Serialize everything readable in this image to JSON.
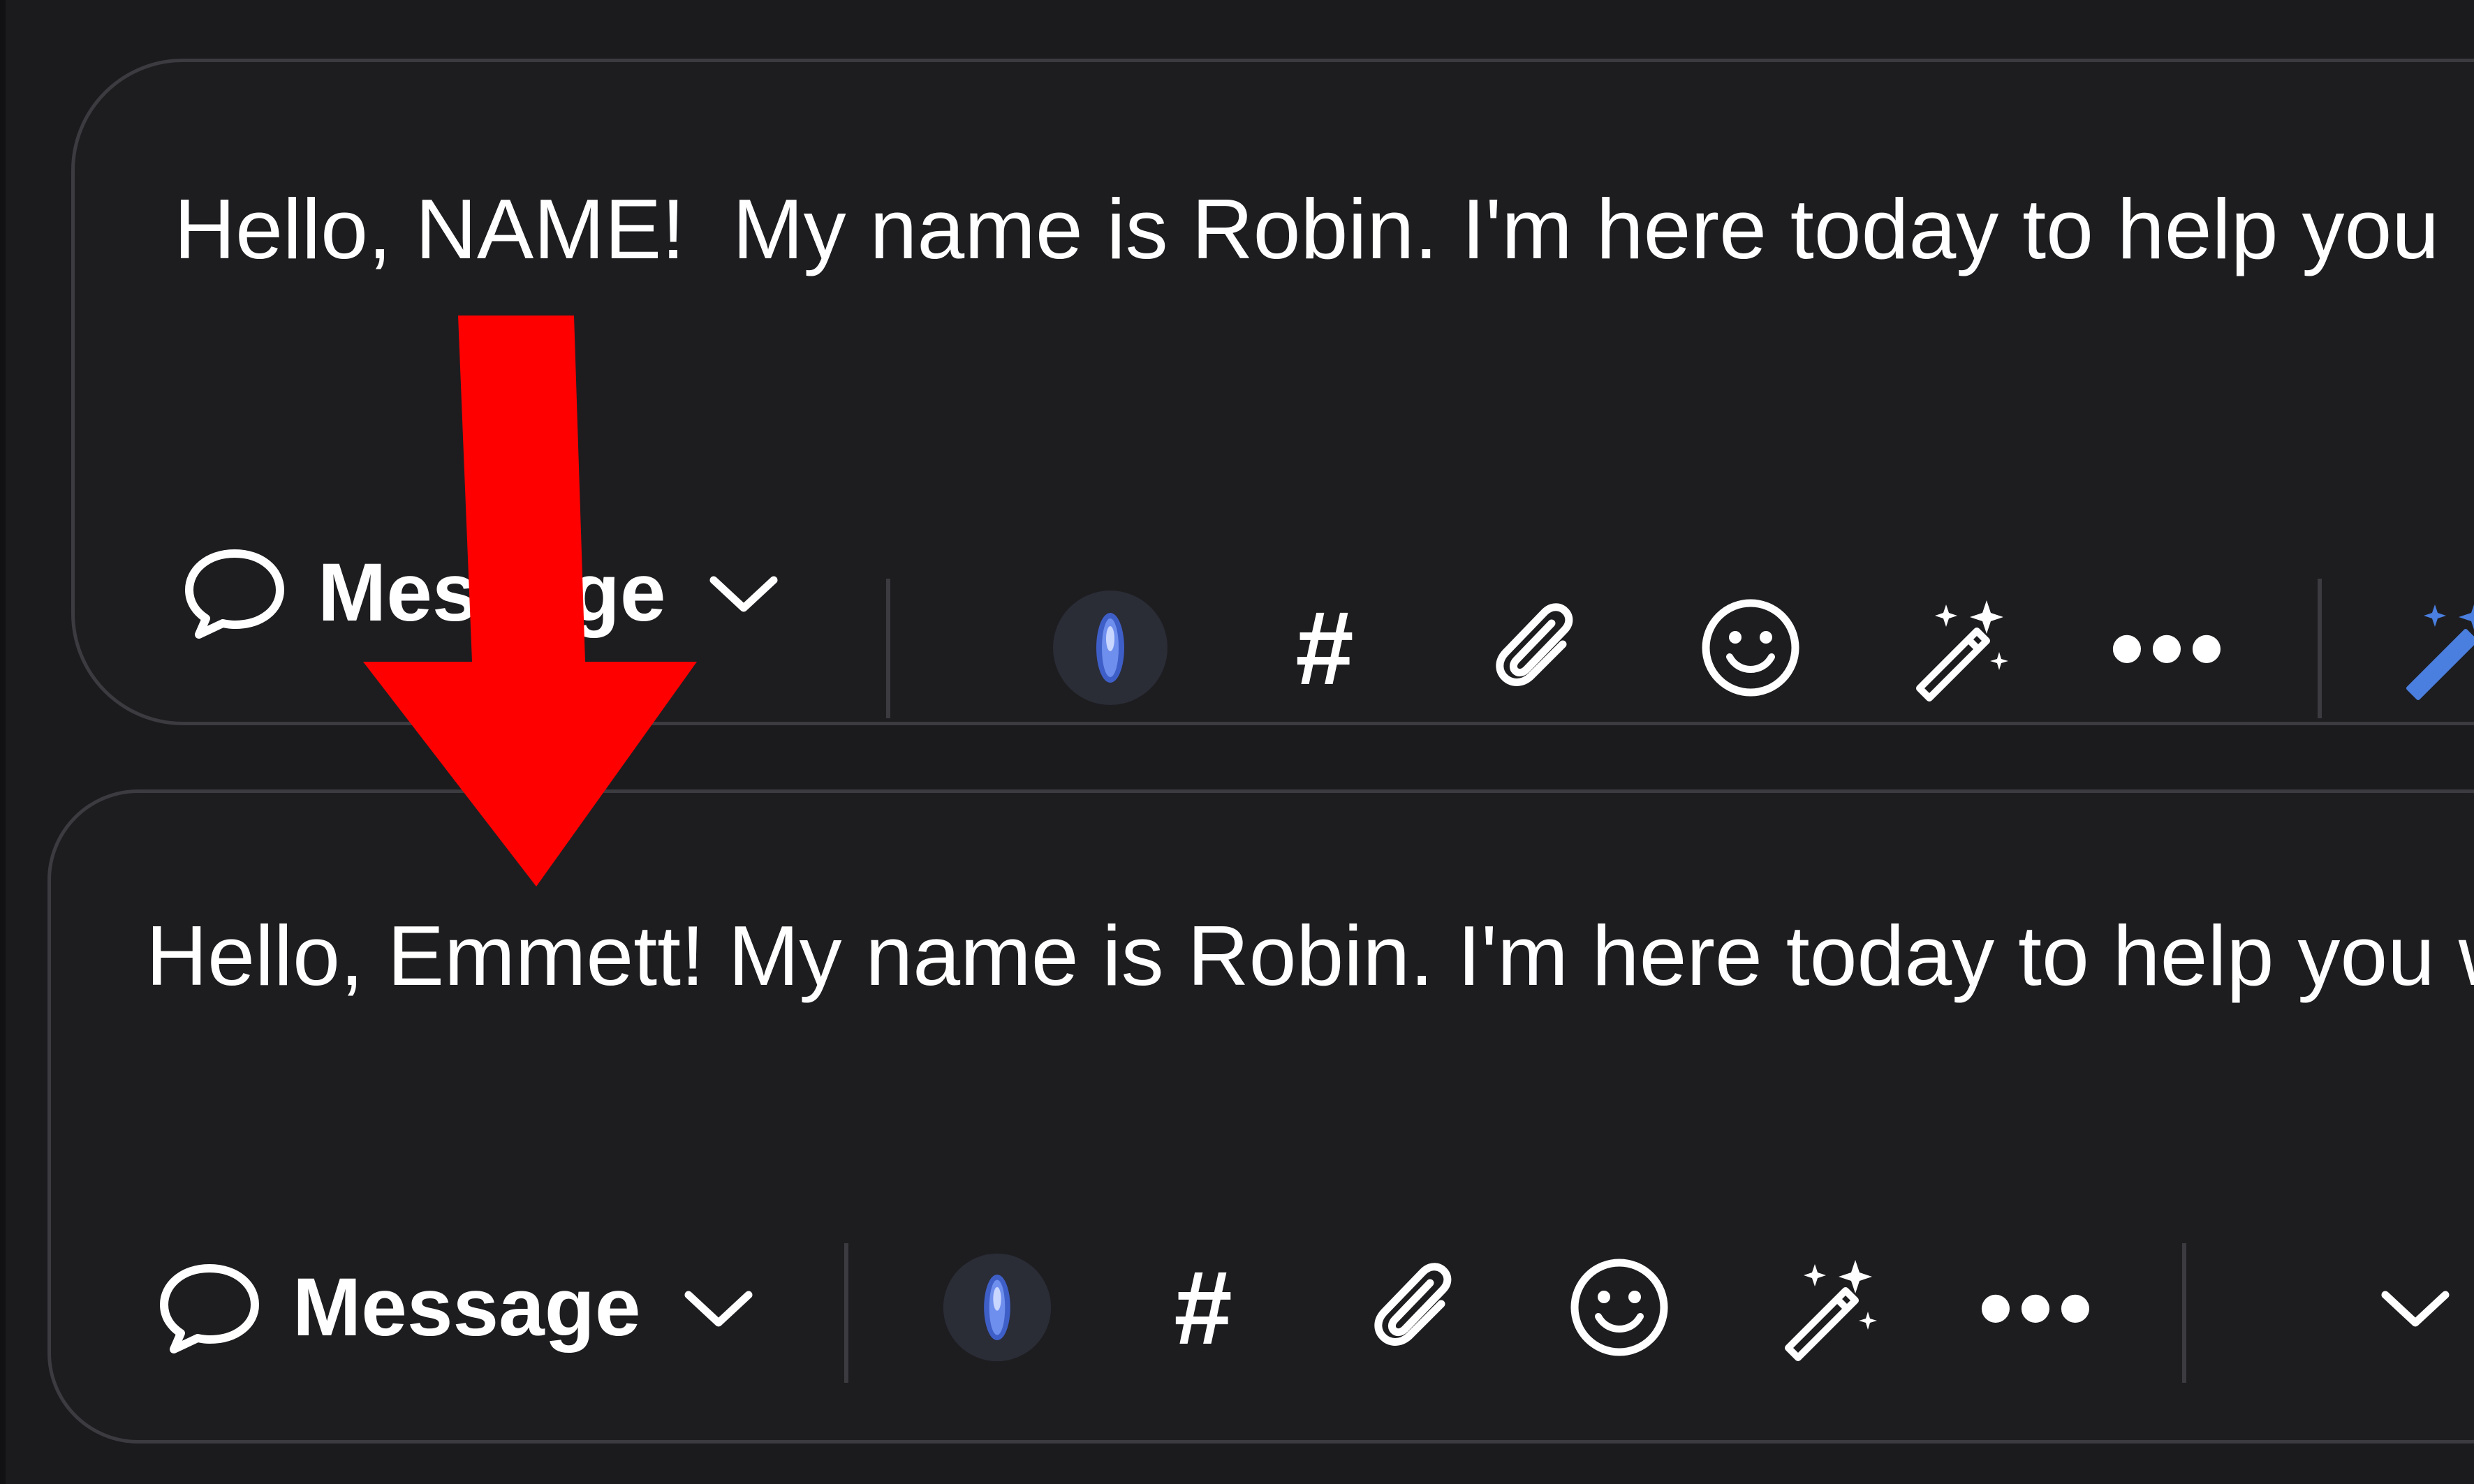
{
  "composer_before": {
    "message_text": "Hello, NAME!  My name is Robin. I'm here today to help you",
    "mode_label": "Message",
    "mode_icon": "chat-bubble-icon",
    "tools": [
      "ai-orb-icon",
      "hashtag-icon",
      "paperclip-icon",
      "smiley-icon",
      "magic-wand-icon",
      "more-icon"
    ],
    "trailing_icon": "magic-wand-icon"
  },
  "composer_after": {
    "message_text": "Hello, Emmett! My name is Robin. I'm here today to help you w",
    "mode_label": "Message",
    "mode_icon": "chat-bubble-icon",
    "tools": [
      "ai-orb-icon",
      "hashtag-icon",
      "paperclip-icon",
      "smiley-icon",
      "magic-wand-icon",
      "more-icon"
    ],
    "trailing_icon": "chevron-down-icon"
  },
  "tool_glyphs": {
    "hashtag": "#",
    "more": "•••"
  },
  "colors": {
    "background": "#1b1b1e",
    "panel": "#1d1d20",
    "panel_border": "#3b3b40",
    "text": "#ffffff",
    "annotation_arrow": "#ff0000",
    "accent_blue": "#4a7fe0"
  }
}
